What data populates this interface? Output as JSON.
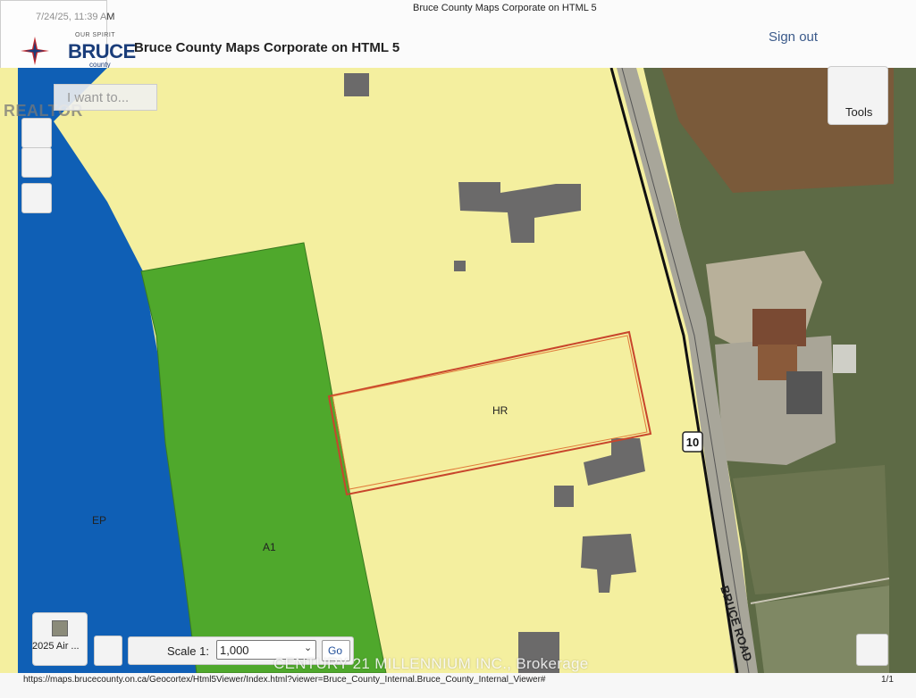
{
  "print_header": {
    "datetime": "7/24/25, 11:39 AM",
    "page_title": "Bruce County Maps Corporate on HTML 5"
  },
  "logo": {
    "name": "BRUCE",
    "sub": "county",
    "tagline": "OUR SPIRIT"
  },
  "app": {
    "title": "Bruce County Maps Corporate on HTML 5",
    "sign_out": "Sign out",
    "i_want_to": "I want to...",
    "tools": "Tools"
  },
  "realtor_watermark": "REALTOR",
  "map": {
    "zones": {
      "ep": "EP",
      "a1": "A1",
      "hr": "HR"
    },
    "highway_shield": "10",
    "road_name": "BRUCE ROAD",
    "colors": {
      "ep_zone": "#0f5fb5",
      "a1_zone": "#4fa82c",
      "residential_zone": "#f4ef9f",
      "building": "#6b6a6a",
      "parcel_outline": "#c8452c"
    }
  },
  "basemap": {
    "label": "2025 Air ..."
  },
  "scale": {
    "label": "Scale 1:",
    "value": "1,000",
    "go": "Go"
  },
  "watermark": "CENTURY 21 MILLENNIUM INC., Brokerage",
  "footer": {
    "url": "https://maps.brucecounty.on.ca/Geocortex/Html5Viewer/Index.html?viewer=Bruce_County_Internal.Bruce_County_Internal_Viewer#",
    "page": "1/1"
  }
}
